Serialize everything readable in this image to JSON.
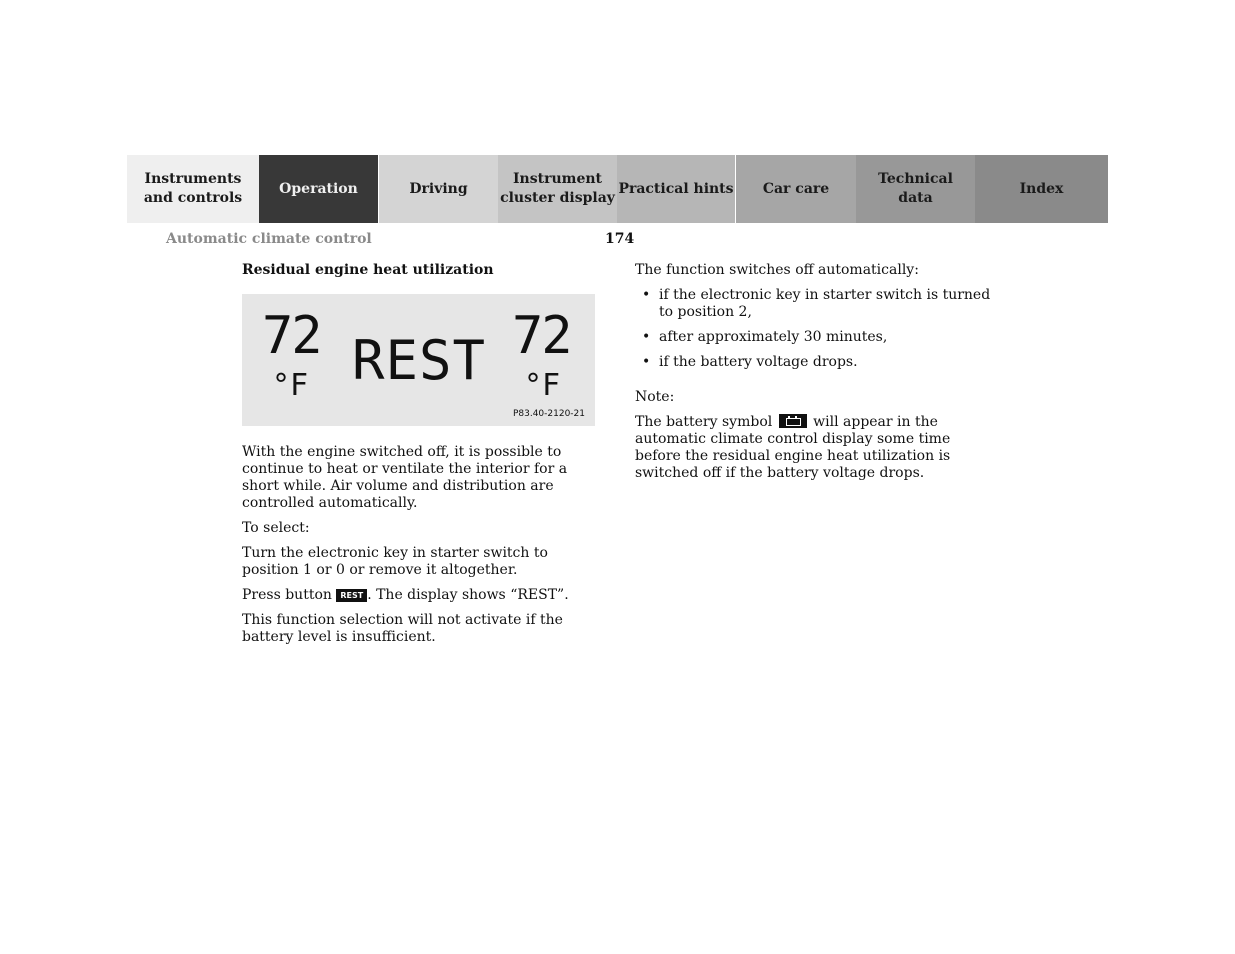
{
  "nav": {
    "tabs": [
      {
        "label": "Instruments\nand controls",
        "active": false
      },
      {
        "label": "Operation",
        "active": true
      },
      {
        "label": "Driving",
        "active": false
      },
      {
        "label": "Instrument\ncluster display",
        "active": false
      },
      {
        "label": "Practical hints",
        "active": false
      },
      {
        "label": "Car care",
        "active": false
      },
      {
        "label": "Technical\ndata",
        "active": false
      },
      {
        "label": "Index",
        "active": false
      }
    ]
  },
  "header": {
    "section_title": "Automatic climate control",
    "page_number": "174"
  },
  "left": {
    "heading": "Residual engine heat utilization",
    "display": {
      "left_temp": "72",
      "left_unit": "°F",
      "center_text": "REST",
      "right_temp": "72",
      "right_unit": "°F",
      "figure_code": "P83.40-2120-21"
    },
    "para1": "With the engine switched off, it is possible to continue to heat or ventilate the interior for a short while. Air volume and distribution are controlled automatically.",
    "para2": "To select:",
    "para3": "Turn the electronic key in starter switch to position 1 or 0 or remove it altogether.",
    "para4_before": "Press button ",
    "para4_button": "REST",
    "para4_after": ". The display shows “REST”.",
    "para5": "This function selection will not activate if the battery level is insufficient."
  },
  "right": {
    "intro": "The function switches off automatically:",
    "bullets": [
      "if the electronic key in starter switch is turned to position 2,",
      "after approximately 30 minutes,",
      "if the battery voltage drops."
    ],
    "note_label": "Note:",
    "note_before": "The battery symbol ",
    "note_icon": "battery-icon",
    "note_after": " will appear in the automatic climate control display some time before the residual engine heat utilization is switched off if the battery voltage drops."
  }
}
